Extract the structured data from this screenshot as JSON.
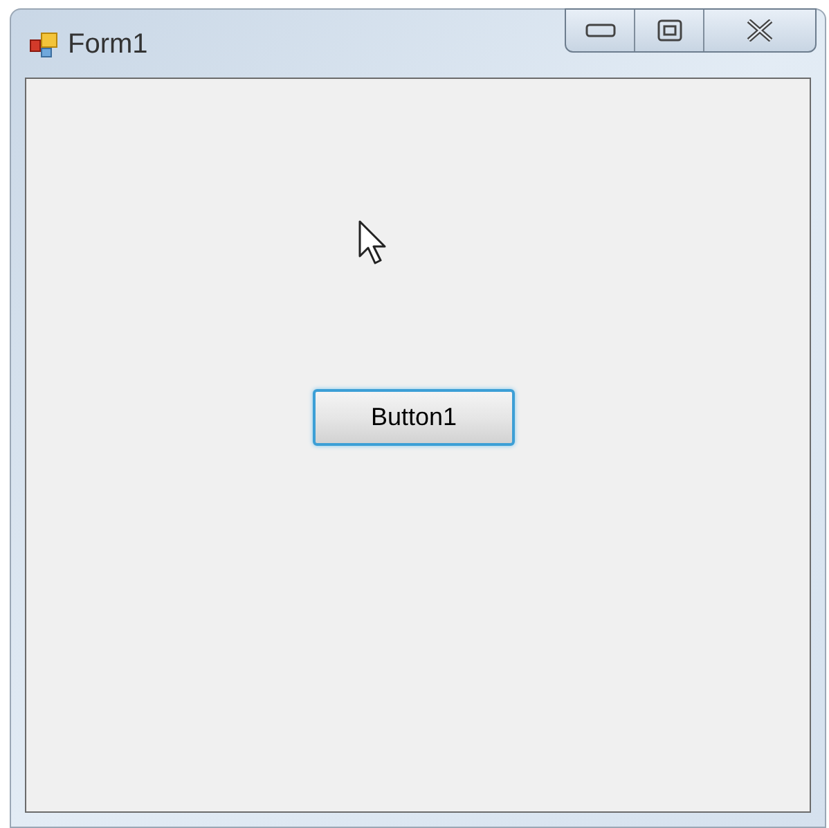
{
  "window": {
    "title": "Form1"
  },
  "button": {
    "label": "Button1",
    "focused": true
  }
}
